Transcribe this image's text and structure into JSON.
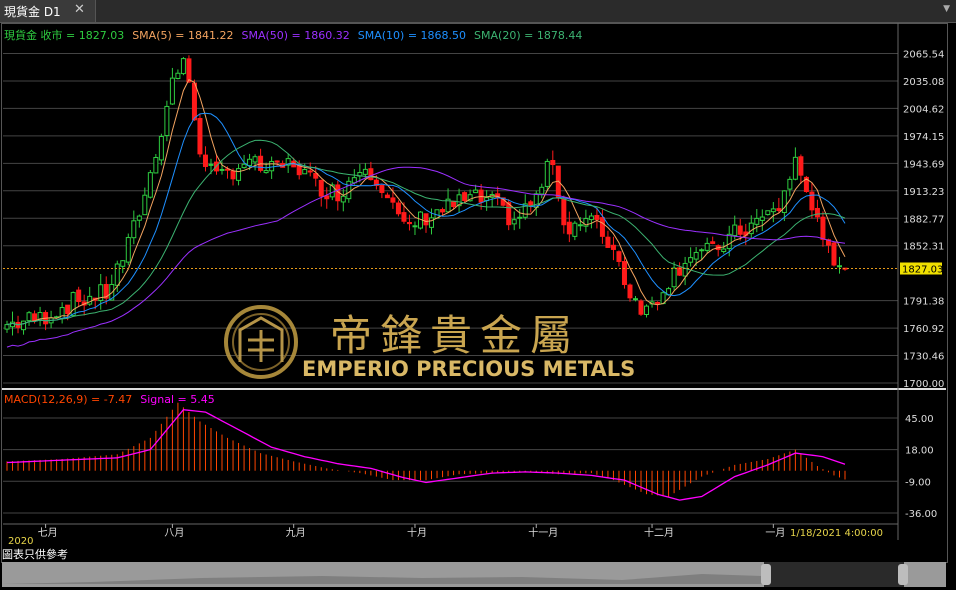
{
  "tab": {
    "title": "現貨金 D1"
  },
  "note": "圖表只供參考",
  "watermark": {
    "cn": "帝鋒貴金屬",
    "en": "EMPERIO PRECIOUS METALS"
  },
  "chart_data": [
    {
      "type": "line",
      "title": "現貨金 收市 = 1827.03",
      "legend": [
        {
          "label": "現貨金 收市 = 1827.03",
          "color": "#2ecc40"
        },
        {
          "label": "SMA(5) = 1841.22",
          "color": "#f4a460"
        },
        {
          "label": "SMA(50) = 1860.32",
          "color": "#9b30ff"
        },
        {
          "label": "SMA(10) = 1868.50",
          "color": "#1e90ff"
        },
        {
          "label": "SMA(20) = 1878.44",
          "color": "#3cb371"
        }
      ],
      "yticks": [
        "2065.54",
        "2035.08",
        "2004.62",
        "1974.15",
        "1943.69",
        "1913.23",
        "1882.77",
        "1852.31",
        "1791.38",
        "1760.92",
        "1730.46",
        "1700.00"
      ],
      "ylim": [
        1700,
        2075
      ],
      "current_price": "1827.03",
      "xticks": [
        {
          "label": "七月",
          "day": 7
        },
        {
          "label": "八月",
          "day": 30
        },
        {
          "label": "九月",
          "day": 52
        },
        {
          "label": "十月",
          "day": 74
        },
        {
          "label": "十一月",
          "day": 96
        },
        {
          "label": "十二月",
          "day": 117
        },
        {
          "label": "一月",
          "day": 139
        }
      ],
      "year_label": "2020",
      "last_time_label": "1/18/2021 4:00:00",
      "anchors_close": [
        [
          0,
          1765
        ],
        [
          6,
          1772
        ],
        [
          12,
          1790
        ],
        [
          18,
          1800
        ],
        [
          22,
          1852
        ],
        [
          26,
          1930
        ],
        [
          30,
          2035
        ],
        [
          32,
          2060
        ],
        [
          35,
          1960
        ],
        [
          38,
          1925
        ],
        [
          43,
          1945
        ],
        [
          48,
          1935
        ],
        [
          52,
          1945
        ],
        [
          56,
          1920
        ],
        [
          60,
          1910
        ],
        [
          65,
          1945
        ],
        [
          68,
          1920
        ],
        [
          72,
          1870
        ],
        [
          76,
          1885
        ],
        [
          80,
          1895
        ],
        [
          84,
          1905
        ],
        [
          88,
          1900
        ],
        [
          92,
          1880
        ],
        [
          96,
          1905
        ],
        [
          99,
          1950
        ],
        [
          101,
          1875
        ],
        [
          106,
          1880
        ],
        [
          110,
          1850
        ],
        [
          113,
          1800
        ],
        [
          116,
          1780
        ],
        [
          120,
          1815
        ],
        [
          124,
          1845
        ],
        [
          128,
          1845
        ],
        [
          132,
          1865
        ],
        [
          136,
          1878
        ],
        [
          140,
          1895
        ],
        [
          143,
          1945
        ],
        [
          146,
          1900
        ],
        [
          148,
          1850
        ],
        [
          150,
          1840
        ],
        [
          152,
          1827
        ]
      ],
      "series": [
        {
          "name": "SMA(5)",
          "period": 5,
          "color": "#f4a460"
        },
        {
          "name": "SMA(10)",
          "period": 10,
          "color": "#1e90ff"
        },
        {
          "name": "SMA(20)",
          "period": 20,
          "color": "#3cb371"
        },
        {
          "name": "SMA(50)",
          "period": 50,
          "color": "#9b30ff"
        }
      ]
    },
    {
      "type": "bar",
      "title": "MACD(12,26,9) = -7.47",
      "legend": [
        {
          "label": "MACD(12,26,9) = -7.47",
          "color": "#ff4500"
        },
        {
          "label": "Signal = 5.45",
          "color": "#ff00ff"
        }
      ],
      "yticks": [
        "45.00",
        "18.00",
        "-9.00",
        "-36.00"
      ],
      "ylim": [
        -42,
        62
      ],
      "macd_anchors": [
        [
          0,
          8
        ],
        [
          10,
          10
        ],
        [
          20,
          14
        ],
        [
          26,
          28
        ],
        [
          31,
          58
        ],
        [
          35,
          42
        ],
        [
          40,
          28
        ],
        [
          46,
          15
        ],
        [
          52,
          8
        ],
        [
          58,
          2
        ],
        [
          64,
          -2
        ],
        [
          70,
          -8
        ],
        [
          76,
          -8
        ],
        [
          82,
          -3
        ],
        [
          88,
          -2
        ],
        [
          94,
          -1
        ],
        [
          100,
          -3
        ],
        [
          106,
          -2
        ],
        [
          110,
          -8
        ],
        [
          116,
          -20
        ],
        [
          120,
          -22
        ],
        [
          126,
          -5
        ],
        [
          132,
          5
        ],
        [
          138,
          10
        ],
        [
          143,
          18
        ],
        [
          147,
          4
        ],
        [
          150,
          -4
        ],
        [
          152,
          -7.47
        ]
      ],
      "signal_anchors": [
        [
          0,
          7
        ],
        [
          10,
          9
        ],
        [
          20,
          11
        ],
        [
          26,
          18
        ],
        [
          32,
          52
        ],
        [
          36,
          50
        ],
        [
          42,
          35
        ],
        [
          48,
          20
        ],
        [
          54,
          12
        ],
        [
          60,
          6
        ],
        [
          66,
          2
        ],
        [
          72,
          -6
        ],
        [
          76,
          -10
        ],
        [
          82,
          -6
        ],
        [
          88,
          -2
        ],
        [
          94,
          -1
        ],
        [
          100,
          -2
        ],
        [
          106,
          -4
        ],
        [
          112,
          -8
        ],
        [
          118,
          -20
        ],
        [
          122,
          -25
        ],
        [
          126,
          -22
        ],
        [
          132,
          -5
        ],
        [
          138,
          5
        ],
        [
          143,
          15
        ],
        [
          148,
          12
        ],
        [
          152,
          5.45
        ]
      ]
    }
  ]
}
